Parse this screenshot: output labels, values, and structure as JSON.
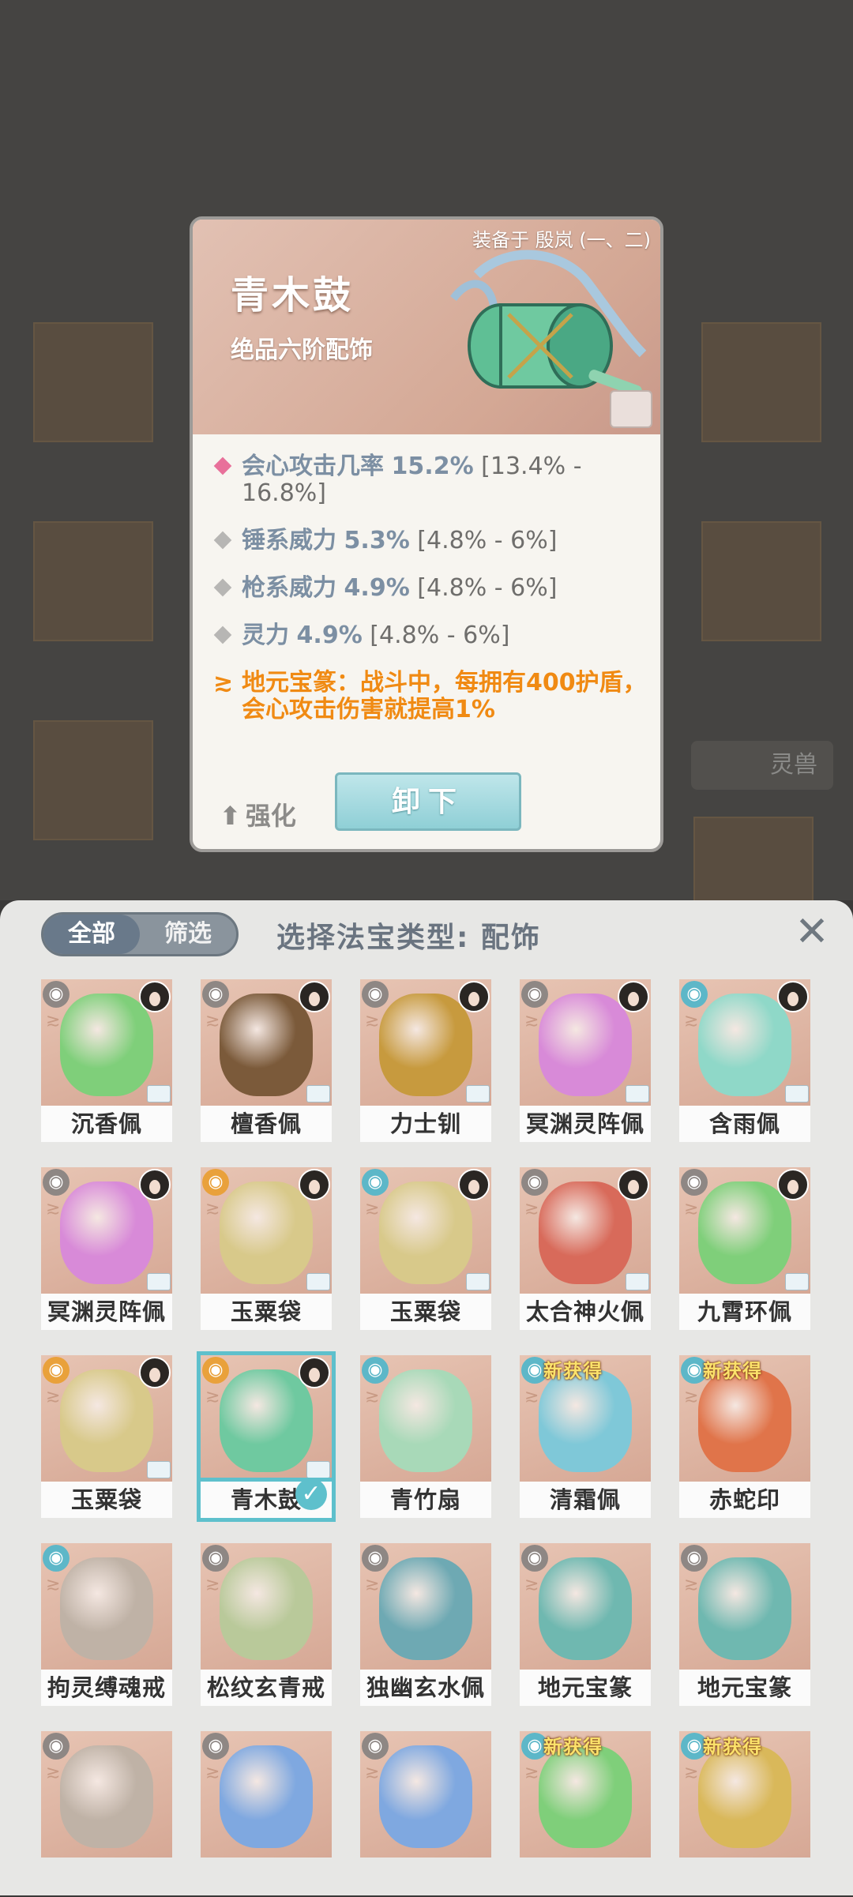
{
  "background": {
    "side_tab_label": "灵兽"
  },
  "detail": {
    "equipped_label": "装备于 殷岚 (一、二)",
    "item_name": "青木鼓",
    "item_grade": "绝品六阶配饰",
    "stats": [
      {
        "name": "会心攻击几率",
        "value": "15.2%",
        "range": "[13.4% - 16.8%]",
        "highlight": true
      },
      {
        "name": "锤系威力",
        "value": "5.3%",
        "range": "[4.8% - 6%]",
        "highlight": false
      },
      {
        "name": "枪系威力",
        "value": "4.9%",
        "range": "[4.8% - 6%]",
        "highlight": false
      },
      {
        "name": "灵力",
        "value": "4.9%",
        "range": "[4.8% - 6%]",
        "highlight": false
      }
    ],
    "special_effect": "地元宝篆：战斗中，每拥有400护盾，会心攻击伤害就提高1%",
    "strengthen_label": "强化",
    "unequip_label": "卸下"
  },
  "sheet": {
    "segment_all": "全部",
    "segment_filter": "筛选",
    "title": "选择法宝类型: 配饰",
    "close_icon": "close-icon",
    "new_tag": "新获得",
    "items": [
      {
        "label": "沉香佩",
        "color": "#7fcf7a",
        "badge": "gray",
        "avatar": true
      },
      {
        "label": "檀香佩",
        "color": "#7b5a3a",
        "badge": "gray",
        "avatar": true
      },
      {
        "label": "力士钏",
        "color": "#c79a3e",
        "badge": "gray",
        "avatar": true
      },
      {
        "label": "冥渊灵阵佩",
        "color": "#d88ad8",
        "badge": "gray",
        "avatar": true
      },
      {
        "label": "含雨佩",
        "color": "#8fd8c8",
        "badge": "cyan",
        "avatar": true
      },
      {
        "label": "冥渊灵阵佩",
        "color": "#d88ad8",
        "badge": "gray",
        "avatar": true
      },
      {
        "label": "玉粟袋",
        "color": "#d8c98a",
        "badge": "orange",
        "avatar": true
      },
      {
        "label": "玉粟袋",
        "color": "#d8c98a",
        "badge": "cyan",
        "avatar": true
      },
      {
        "label": "太合神火佩",
        "color": "#d86a5a",
        "badge": "gray",
        "avatar": true
      },
      {
        "label": "九霄环佩",
        "color": "#7fcf7a",
        "badge": "gray",
        "avatar": true
      },
      {
        "label": "玉粟袋",
        "color": "#d8c98a",
        "badge": "orange",
        "avatar": true
      },
      {
        "label": "青木鼓",
        "color": "#6fc9a0",
        "badge": "orange",
        "avatar": true,
        "selected": true
      },
      {
        "label": "青竹扇",
        "color": "#a8d9b8",
        "badge": "cyan",
        "avatar": false
      },
      {
        "label": "清霜佩",
        "color": "#7fc8d8",
        "badge": "cyan",
        "avatar": false,
        "new": true
      },
      {
        "label": "赤蛇印",
        "color": "#e0744a",
        "badge": "cyan",
        "avatar": false,
        "new": true
      },
      {
        "label": "拘灵缚魂戒",
        "color": "#bfb2a6",
        "badge": "cyan",
        "avatar": false
      },
      {
        "label": "松纹玄青戒",
        "color": "#b9c99a",
        "badge": "gray",
        "avatar": false
      },
      {
        "label": "独幽玄水佩",
        "color": "#6ea9b3",
        "badge": "gray",
        "avatar": false
      },
      {
        "label": "地元宝篆",
        "color": "#6fb8b0",
        "badge": "gray",
        "avatar": false
      },
      {
        "label": "地元宝篆",
        "color": "#6fb8b0",
        "badge": "gray",
        "avatar": false
      },
      {
        "label": "",
        "color": "#bfb2a6",
        "badge": "gray",
        "avatar": false
      },
      {
        "label": "",
        "color": "#7fa8e0",
        "badge": "gray",
        "avatar": false
      },
      {
        "label": "",
        "color": "#7fa8e0",
        "badge": "gray",
        "avatar": false
      },
      {
        "label": "",
        "color": "#7fcf7a",
        "badge": "cyan",
        "avatar": false,
        "new": true
      },
      {
        "label": "",
        "color": "#d9b85a",
        "badge": "cyan",
        "avatar": false,
        "new": true
      }
    ]
  }
}
